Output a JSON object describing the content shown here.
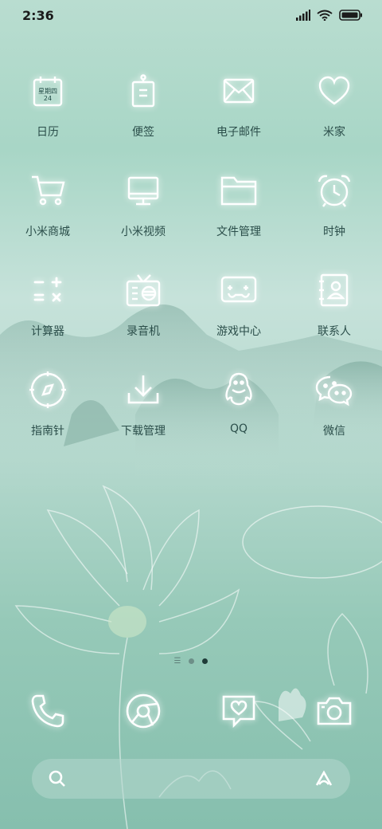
{
  "status_bar": {
    "time": "2:36"
  },
  "apps": [
    {
      "name": "app-calendar",
      "icon": "calendar-icon",
      "label": "日历",
      "sub1": "星期四",
      "sub2": "24"
    },
    {
      "name": "app-notes",
      "icon": "notes-icon",
      "label": "便签"
    },
    {
      "name": "app-email",
      "icon": "mail-icon",
      "label": "电子邮件"
    },
    {
      "name": "app-mi-home",
      "icon": "heart-icon",
      "label": "米家"
    },
    {
      "name": "app-mi-store",
      "icon": "cart-icon",
      "label": "小米商城"
    },
    {
      "name": "app-mi-video",
      "icon": "monitor-icon",
      "label": "小米视频"
    },
    {
      "name": "app-file-manager",
      "icon": "folder-icon",
      "label": "文件管理"
    },
    {
      "name": "app-clock",
      "icon": "alarm-clock-icon",
      "label": "时钟"
    },
    {
      "name": "app-calculator",
      "icon": "calculator-icon",
      "label": "计算器"
    },
    {
      "name": "app-recorder",
      "icon": "radio-icon",
      "label": "录音机"
    },
    {
      "name": "app-game-center",
      "icon": "gamepad-icon",
      "label": "游戏中心"
    },
    {
      "name": "app-contacts",
      "icon": "contacts-icon",
      "label": "联系人"
    },
    {
      "name": "app-compass",
      "icon": "compass-icon",
      "label": "指南针"
    },
    {
      "name": "app-downloads",
      "icon": "download-icon",
      "label": "下载管理"
    },
    {
      "name": "app-qq",
      "icon": "penguin-icon",
      "label": "QQ"
    },
    {
      "name": "app-wechat",
      "icon": "wechat-icon",
      "label": "微信"
    }
  ],
  "dock": [
    {
      "name": "dock-phone",
      "icon": "phone-icon"
    },
    {
      "name": "dock-browser",
      "icon": "browser-icon"
    },
    {
      "name": "dock-messages",
      "icon": "message-heart-icon"
    },
    {
      "name": "dock-camera",
      "icon": "camera-icon"
    }
  ],
  "page_indicator": {
    "pages": 2,
    "active": 2
  },
  "search_bar": {
    "left_icon": "search-icon",
    "right_icon": "assistant-icon"
  }
}
